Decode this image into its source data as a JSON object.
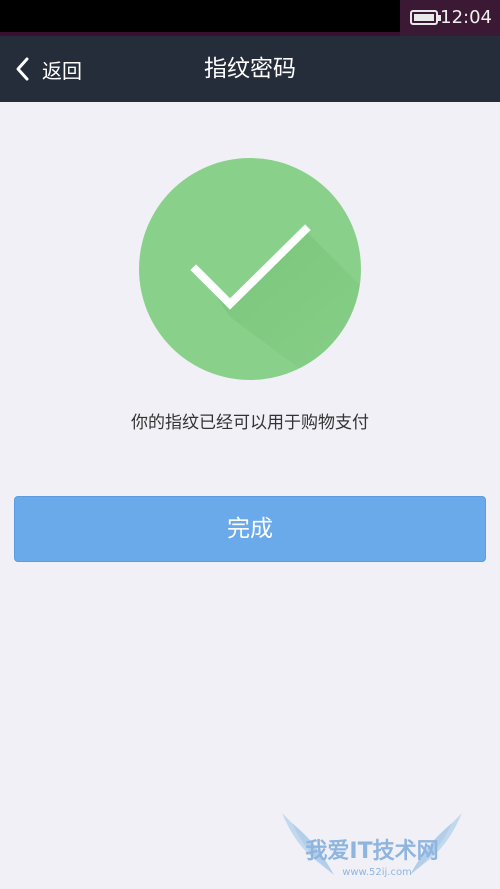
{
  "status_bar": {
    "time": "12:04",
    "battery_icon": "battery-icon"
  },
  "nav": {
    "back_label": "返回",
    "back_icon": "chevron-left-icon",
    "title": "指纹密码"
  },
  "success": {
    "icon": "checkmark-circle-icon",
    "circle_color": "#89d18a",
    "message": "你的指纹已经可以用于购物支付"
  },
  "actions": {
    "done_label": "完成",
    "done_color": "#6aaaea"
  },
  "watermark": {
    "text": "我爱IT技术网",
    "url": "www.52ij.com"
  }
}
